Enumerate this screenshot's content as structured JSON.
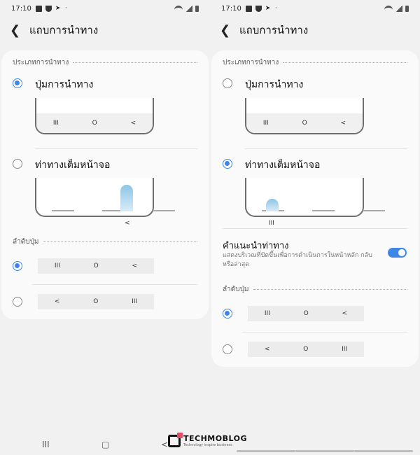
{
  "status": {
    "time": "17:10"
  },
  "appbar": {
    "title": "แถบการนำทาง"
  },
  "nav_type": {
    "header": "ประเภทการนำทาง",
    "buttons_label": "ปุ่มการนำทาง",
    "gestures_label": "ท่าทางเต็มหน้าจอ"
  },
  "nav_preview": {
    "recent": "III",
    "home": "O",
    "back": "<"
  },
  "hint": {
    "title": "คำแนะนำท่าทาง",
    "subtitle": "แสดงบริเวณที่ปัดขึ้นเพื่อการดำเนินการในหน้าหลัก กลับ หรือล่าสุด"
  },
  "order": {
    "header": "ลำดับปุ่ม",
    "option1": [
      "III",
      "O",
      "<"
    ],
    "option2": [
      "<",
      "O",
      "III"
    ]
  },
  "left_screen": {
    "selected": "buttons",
    "order_selected": 1
  },
  "right_screen": {
    "selected": "gestures",
    "hint_enabled": true,
    "order_selected": 1
  },
  "brand": {
    "name": "TECHMOBLOG",
    "tagline": "Technology inspire business"
  },
  "colors": {
    "accent": "#3e86e6",
    "card": "#fafafa",
    "background": "#f1f1f1",
    "brand_accent": "#e64a6b"
  }
}
